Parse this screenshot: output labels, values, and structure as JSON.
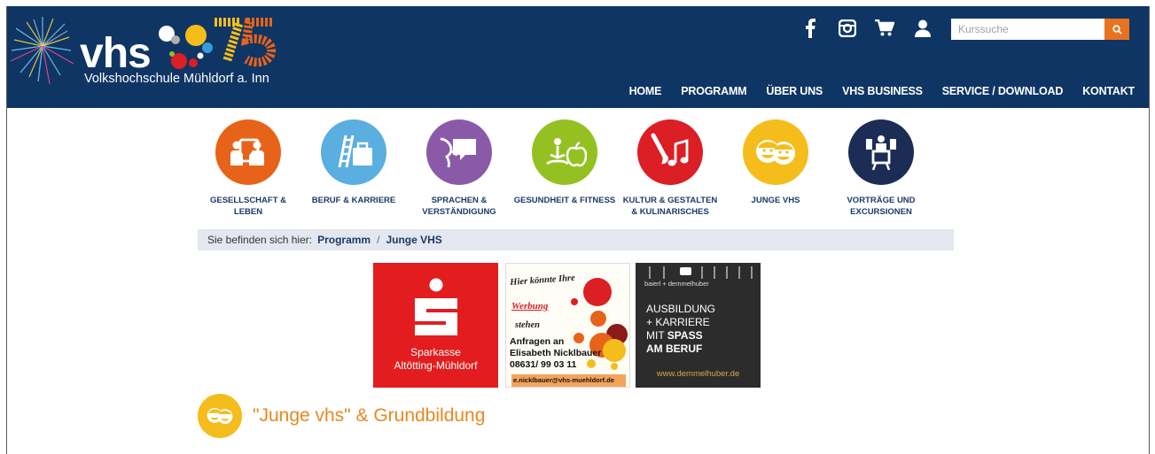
{
  "site": {
    "logo_text": "vhs",
    "logo_badge": "75",
    "subtitle": "Volkshochschule Mühldorf a. Inn"
  },
  "search": {
    "placeholder": "Kurssuche"
  },
  "nav": {
    "items": [
      "HOME",
      "PROGRAMM",
      "ÜBER UNS",
      "VHS BUSINESS",
      "SERVICE / DOWNLOAD",
      "KONTAKT"
    ]
  },
  "categories": [
    {
      "label": "GESELLSCHAFT &",
      "label2": "LEBEN",
      "color": "#e8631a",
      "icon": "people-board-icon"
    },
    {
      "label": "BERUF & KARRIERE",
      "label2": "",
      "color": "#5aaee0",
      "icon": "ladder-briefcase-icon"
    },
    {
      "label": "SPRACHEN &",
      "label2": "VERSTÄNDIGUNG",
      "color": "#8a5aa9",
      "icon": "speech-icon"
    },
    {
      "label": "GESUNDHEIT & FITNESS",
      "label2": "",
      "color": "#94c121",
      "icon": "yoga-apple-icon"
    },
    {
      "label": "KULTUR & GESTALTEN",
      "label2": "& KULINARISCHES",
      "color": "#dc1e25",
      "icon": "brush-music-icon"
    },
    {
      "label": "JUNGE VHS",
      "label2": "",
      "color": "#f4bd1c",
      "icon": "kids-faces-icon"
    },
    {
      "label": "VORTRÄGE UND",
      "label2": "EXCURSIONEN",
      "color": "#1c2d55",
      "icon": "presentation-icon"
    }
  ],
  "breadcrumb": {
    "prefix": "Sie befinden sich hier:",
    "items": [
      "Programm",
      "Junge VHS"
    ],
    "separator": "/"
  },
  "ads": {
    "sparkasse": {
      "line1": "Sparkasse",
      "line2": "Altötting-Mühldorf"
    },
    "werbung": {
      "line1": "Hier könnte Ihre",
      "line2": "Werbung",
      "line3": "stehen",
      "line4": "Anfragen an",
      "line5": "Elisabeth Nicklbauer",
      "line6": "08631/ 99 03 11",
      "line7": "e.nicklbauer@vhs-muehldorf.de"
    },
    "demmelhuber": {
      "brand": "baierl + demmelhuber",
      "line1": "AUSBILDUNG",
      "line2": "+ KARRIERE",
      "line3a": "MIT",
      "line3b": "SPASS",
      "line4": "AM BERUF",
      "url": "www.demmelhuber.de"
    }
  },
  "section": {
    "title": "\"Junge vhs\" & Grundbildung"
  }
}
